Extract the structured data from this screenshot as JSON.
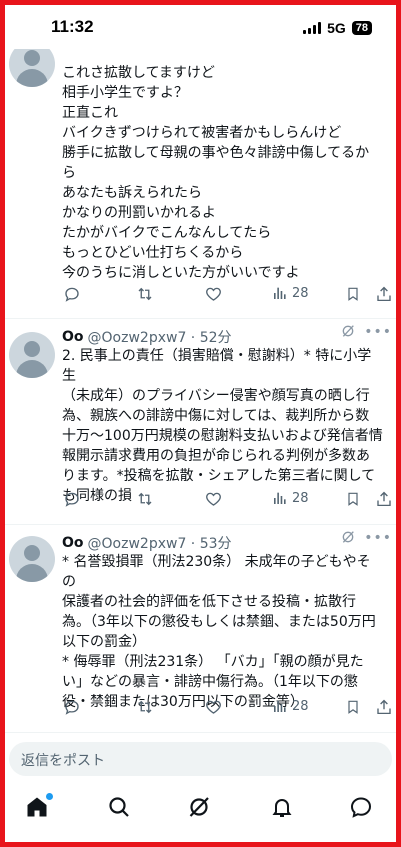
{
  "status_bar": {
    "time": "11:32",
    "network": "5G",
    "battery": "78"
  },
  "posts": [
    {
      "text_lines": [
        "これさ拡散してますけど",
        "相手小学生ですよ？",
        "正直これ",
        "バイクきずつけられて被害者かもしらんけど",
        "勝手に拡散して母親の事や色々誹謗中傷してるか",
        "ら",
        "あなたも訴えられたら",
        "かなりの刑罰いかれるよ",
        "たかがバイクでこんなんしてたら",
        "もっとひどい仕打ちくるから",
        "今のうちに消しといた方がいいですよ"
      ],
      "views": "28"
    },
    {
      "author": "Oo",
      "handle_time": "@Oozw2pxw7 · 52分",
      "text_lines": [
        "2. 民事上の責任（損害賠償・慰謝料）* 特に小学生",
        "（未成年）のプライバシー侵害や顔写真の晒し行",
        "為、親族への誹謗中傷に対しては、裁判所から数",
        "十万〜100万円規模の慰謝料支払いおよび発信者情",
        "報開示請求費用の負担が命じられる判例が多数あ",
        "ります。*投稿を拡散・シェアした第三者に関して",
        "も同様の損"
      ],
      "views": "28"
    },
    {
      "author": "Oo",
      "handle_time": "@Oozw2pxw7 · 53分",
      "text_lines": [
        "* 名誉毀損罪（刑法230条） 未成年の子どもやその",
        "保護者の社会的評価を低下させる投稿・拡散行",
        "為。（3年以下の懲役もしくは禁錮、または50万円",
        "以下の罰金）",
        "* 侮辱罪（刑法231条） 「バカ」「親の顔が見た",
        "い」などの暴言・誹謗中傷行為。（1年以下の懲",
        "役・禁錮または30万円以下の罰金等）"
      ],
      "views": "28"
    }
  ],
  "reply_bar": {
    "placeholder": "返信をポスト"
  },
  "colors": {
    "frame": "#e8141b",
    "accent": "#1d9bf0",
    "muted": "#536471"
  },
  "nav_icons": [
    "home-icon",
    "search-icon",
    "grok-icon",
    "notifications-icon",
    "messages-icon"
  ]
}
